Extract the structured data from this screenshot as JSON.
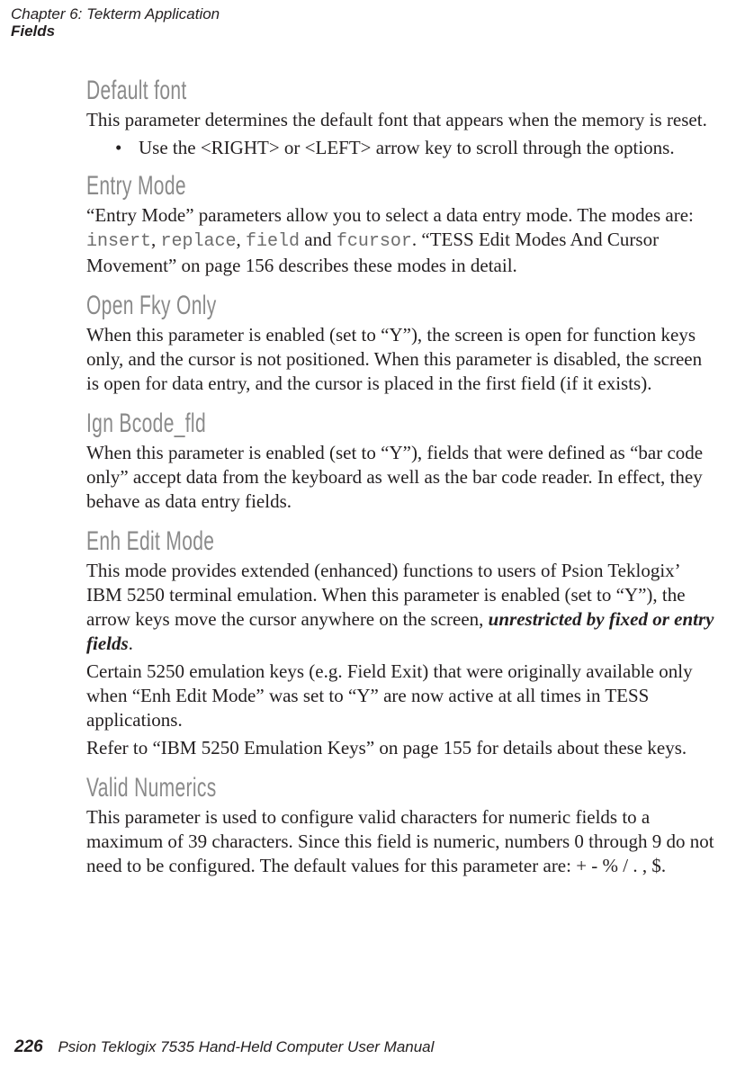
{
  "header": {
    "chapter": "Chapter 6: Tekterm Application",
    "section": "Fields"
  },
  "sections": {
    "default_font": {
      "title": "Default font",
      "p1": "This parameter determines the default font that appears when the memory is reset.",
      "bullet1": "Use the <RIGHT> or <LEFT> arrow key to scroll through the options."
    },
    "entry_mode": {
      "title": "Entry Mode",
      "p1a": "“Entry Mode” parameters allow you to select a data entry mode. The modes are: ",
      "m1": "insert",
      "sep1": ", ",
      "m2": "replace",
      "sep2": ", ",
      "m3": "field",
      "mid": " and ",
      "m4": "fcursor",
      "p1b": ". “TESS Edit Modes And Cursor Movement” on page 156 describes these modes in detail."
    },
    "open_fky": {
      "title": "Open Fky Only",
      "p1": "When this parameter is enabled (set to “Y”), the screen is open for function keys only, and the cursor is not positioned. When this parameter is disabled, the screen is open for data entry, and the cursor is placed in the first field (if it exists)."
    },
    "ign_bcode": {
      "title": "Ign Bcode_fld",
      "p1": "When this parameter is enabled (set to “Y”), fields that were defined as “bar code only” accept data from the keyboard as well as the bar code reader. In effect, they behave as data entry fields."
    },
    "enh_edit": {
      "title": "Enh Edit Mode",
      "p1a": "This mode provides extended (enhanced) functions to users of Psion Teklogix’ IBM 5250 terminal emulation. When this parameter is enabled (set to “Y”), the arrow keys move the cursor anywhere on the screen, ",
      "p1emph": "unrestricted by fixed or entry fields",
      "p1b": ".",
      "p2": "Certain 5250 emulation keys (e.g. Field Exit) that were originally available only when “Enh Edit Mode” was set to “Y” are now active at all times in TESS applications.",
      "p3": "Refer to “IBM 5250 Emulation Keys” on page 155 for details about these keys."
    },
    "valid_numerics": {
      "title": "Valid Numerics",
      "p1": "This parameter is used to configure valid characters for numeric fields to a maximum of 39 characters. Since this field is numeric, numbers 0 through 9 do not need to be configured. The default values for this parameter are: + - % / . , $."
    }
  },
  "footer": {
    "page": "226",
    "title": "Psion Teklogix 7535 Hand-Held Computer User Manual"
  }
}
